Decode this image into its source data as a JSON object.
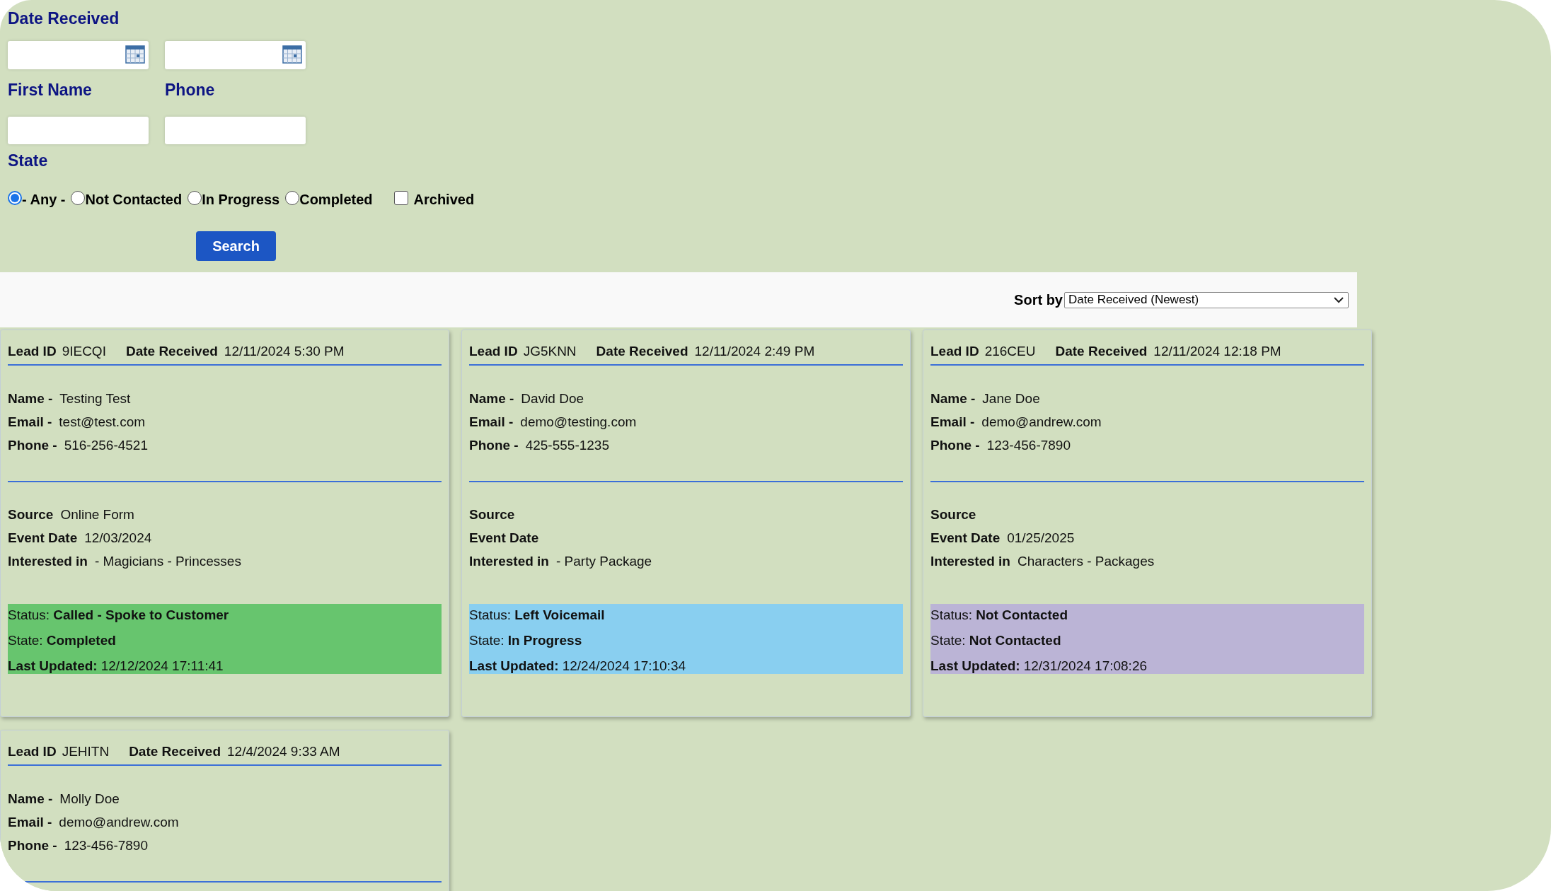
{
  "filters": {
    "date_label": "Date Received",
    "first_name_label": "First Name",
    "phone_label": "Phone",
    "state_label": "State",
    "state_options": [
      {
        "label": "- Any -",
        "selected": true
      },
      {
        "label": "Not Contacted",
        "selected": false
      },
      {
        "label": "In Progress",
        "selected": false
      },
      {
        "label": "Completed",
        "selected": false
      }
    ],
    "archived": {
      "label": "Archived",
      "checked": false
    },
    "search_button": "Search"
  },
  "sort": {
    "label": "Sort by",
    "value": "Date Received (Newest)"
  },
  "leads": [
    {
      "lead_id_label": "Lead ID",
      "lead_id": "9IECQI",
      "date_label": "Date Received",
      "date": "12/11/2024 5:30 PM",
      "contact": [
        {
          "label": "Name -",
          "value": "Testing Test"
        },
        {
          "label": "Email -",
          "value": "test@test.com"
        },
        {
          "label": "Phone -",
          "value": "516-256-4521"
        }
      ],
      "details": [
        {
          "label": "Source",
          "value": "Online Form"
        },
        {
          "label": "Event Date",
          "value": "12/03/2024"
        },
        {
          "label": "Interested in",
          "value": "- Magicians - Princesses"
        }
      ],
      "status": {
        "color": "#67c56e",
        "rows": [
          {
            "kind": "bold_value",
            "label": "Status:",
            "value": "Called - Spoke to Customer"
          },
          {
            "kind": "bold_value",
            "label": "State:",
            "value": "Completed"
          },
          {
            "kind": "bold_label",
            "label": "Last Updated:",
            "value": "12/12/2024 17:11:41"
          }
        ]
      }
    },
    {
      "lead_id_label": "Lead ID",
      "lead_id": "JG5KNN",
      "date_label": "Date Received",
      "date": "12/11/2024 2:49 PM",
      "contact": [
        {
          "label": "Name -",
          "value": "David Doe"
        },
        {
          "label": "Email -",
          "value": "demo@testing.com"
        },
        {
          "label": "Phone -",
          "value": "425-555-1235"
        }
      ],
      "details": [
        {
          "label": "Source"
        },
        {
          "label": "Event Date"
        },
        {
          "label": "Interested in",
          "value": "- Party Package"
        }
      ],
      "status": {
        "color": "#89cff0",
        "rows": [
          {
            "kind": "bold_value",
            "label": "Status:",
            "value": "Left Voicemail"
          },
          {
            "kind": "bold_value",
            "label": "State:",
            "value": "In Progress"
          },
          {
            "kind": "bold_label",
            "label": "Last Updated:",
            "value": "12/24/2024 17:10:34"
          }
        ]
      }
    },
    {
      "lead_id_label": "Lead ID",
      "lead_id": "216CEU",
      "date_label": "Date Received",
      "date": "12/11/2024 12:18 PM",
      "contact": [
        {
          "label": "Name -",
          "value": "Jane Doe"
        },
        {
          "label": "Email -",
          "value": "demo@andrew.com"
        },
        {
          "label": "Phone -",
          "value": "123-456-7890"
        }
      ],
      "details": [
        {
          "label": "Source"
        },
        {
          "label": "Event Date",
          "value": "01/25/2025"
        },
        {
          "label": "Interested in",
          "value": "Characters - Packages"
        }
      ],
      "status": {
        "color": "#bbb4d6",
        "rows": [
          {
            "kind": "bold_value",
            "label": "Status:",
            "value": "Not Contacted"
          },
          {
            "kind": "bold_value",
            "label": "State:",
            "value": "Not Contacted"
          },
          {
            "kind": "bold_label",
            "label": "Last Updated:",
            "value": "12/31/2024 17:08:26"
          }
        ]
      }
    },
    {
      "lead_id_label": "Lead ID",
      "lead_id": "JEHITN",
      "date_label": "Date Received",
      "date": "12/4/2024 9:33 AM",
      "contact": [
        {
          "label": "Name -",
          "value": "Molly Doe"
        },
        {
          "label": "Email -",
          "value": "demo@andrew.com"
        },
        {
          "label": "Phone -",
          "value": "123-456-7890"
        }
      ]
    }
  ]
}
